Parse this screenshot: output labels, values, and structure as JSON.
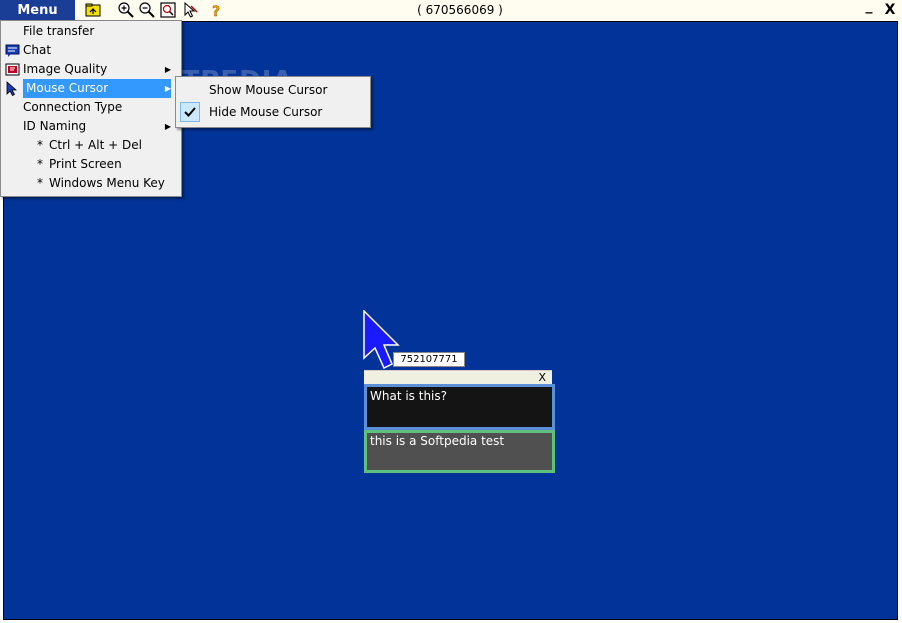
{
  "toolbar": {
    "menu_label": "Menu",
    "session_id": "( 670566069 )",
    "minimize_label": "_",
    "close_label": "X",
    "icons": [
      "folder-transfer-icon",
      "zoom-in-icon",
      "zoom-out-icon",
      "fit-screen-icon",
      "pointer-icon",
      "help-icon"
    ]
  },
  "watermark": "SOFTPEDIA",
  "main_menu": {
    "items": [
      {
        "label": "File transfer",
        "icon": "",
        "submenu": false
      },
      {
        "label": "Chat",
        "icon": "chat-icon",
        "submenu": false
      },
      {
        "label": "Image Quality",
        "icon": "image-quality-icon",
        "submenu": true
      },
      {
        "label": "Mouse Cursor",
        "icon": "cursor-icon",
        "submenu": true,
        "selected": true
      },
      {
        "label": "Connection Type",
        "icon": "",
        "submenu": false
      },
      {
        "label": "ID Naming",
        "icon": "",
        "submenu": true
      },
      {
        "label": "Ctrl + Alt + Del",
        "star": "*"
      },
      {
        "label": "Print Screen",
        "star": "*"
      },
      {
        "label": "Windows Menu Key",
        "star": "*"
      }
    ]
  },
  "sub_menu": {
    "items": [
      {
        "label": "Show Mouse Cursor",
        "checked": false
      },
      {
        "label": "Hide Mouse Cursor",
        "checked": true
      }
    ]
  },
  "remote_cursor": {
    "label": "752107771"
  },
  "chat": {
    "close_label": "X",
    "incoming_message": "What is this?",
    "outgoing_message": "this is a Softpedia test"
  },
  "colors": {
    "desktop": "#023398",
    "menu_button": "#1a3d96",
    "selection": "#3399ff",
    "chat_incoming_border": "#5b8fd8",
    "chat_input_border": "#5ec07e"
  }
}
